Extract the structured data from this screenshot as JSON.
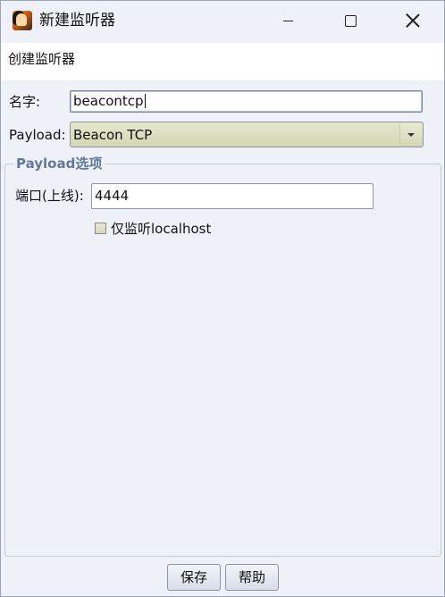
{
  "window": {
    "title": "新建监听器",
    "icon": "app-avatar-icon",
    "controls": {
      "minimize": "minimize-icon",
      "maximize": "maximize-icon",
      "close": "close-icon"
    }
  },
  "header": {
    "text": "创建监听器"
  },
  "form": {
    "name_label": "名字:",
    "name_value": "beacontcp",
    "payload_label": "Payload:",
    "payload_value": "Beacon TCP"
  },
  "options": {
    "group_title": "Payload选项",
    "port_label": "端口(上线):",
    "port_value": "4444",
    "localhost_only_label": "仅监听localhost",
    "localhost_only_checked": false
  },
  "buttons": {
    "save": "保存",
    "help": "帮助"
  },
  "colors": {
    "window_bg": "#eef1f8",
    "select_bg": "#d9dcbc",
    "group_title": "#63789a"
  }
}
